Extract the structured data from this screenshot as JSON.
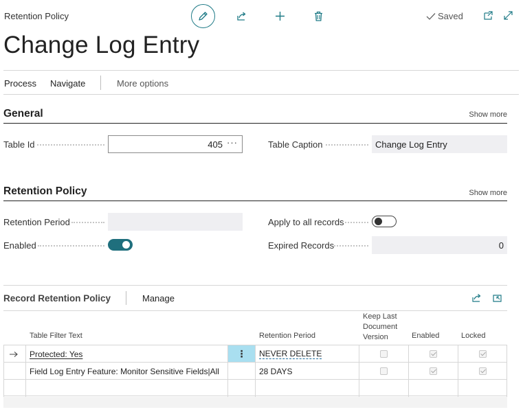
{
  "header": {
    "breadcrumb": "Retention Policy",
    "saved_label": "Saved",
    "icons": [
      "edit-icon",
      "share-icon",
      "add-icon",
      "delete-icon",
      "check-icon",
      "open-new-window-icon",
      "expand-icon"
    ],
    "accent_color": "#1e7a86"
  },
  "page": {
    "title": "Change Log Entry"
  },
  "actions": {
    "process": "Process",
    "navigate": "Navigate",
    "more_options": "More options"
  },
  "general": {
    "title": "General",
    "show_more": "Show more",
    "table_id_label": "Table Id",
    "table_id_value": "405",
    "table_caption_label": "Table Caption",
    "table_caption_value": "Change Log Entry"
  },
  "retention": {
    "title": "Retention Policy",
    "show_more": "Show more",
    "retention_period_label": "Retention Period",
    "retention_period_value": "",
    "apply_all_label": "Apply to all records",
    "apply_all_on": false,
    "enabled_label": "Enabled",
    "enabled_on": true,
    "expired_records_label": "Expired Records",
    "expired_records_value": "0"
  },
  "record_policy": {
    "title": "Record Retention Policy",
    "manage": "Manage",
    "columns": {
      "table_filter_text": "Table Filter Text",
      "retention_period": "Retention Period",
      "keep_last_line1": "Keep Last",
      "keep_last_line2": "Document",
      "keep_last_line3": "Version",
      "enabled": "Enabled",
      "locked": "Locked"
    },
    "rows": [
      {
        "filter": "Protected: Yes",
        "period": "NEVER DELETE",
        "keep_last": false,
        "enabled": true,
        "locked": true
      },
      {
        "filter": "Field Log Entry Feature: Monitor Sensitive Fields|All",
        "period": "28 DAYS",
        "keep_last": false,
        "enabled": true,
        "locked": true
      }
    ]
  }
}
